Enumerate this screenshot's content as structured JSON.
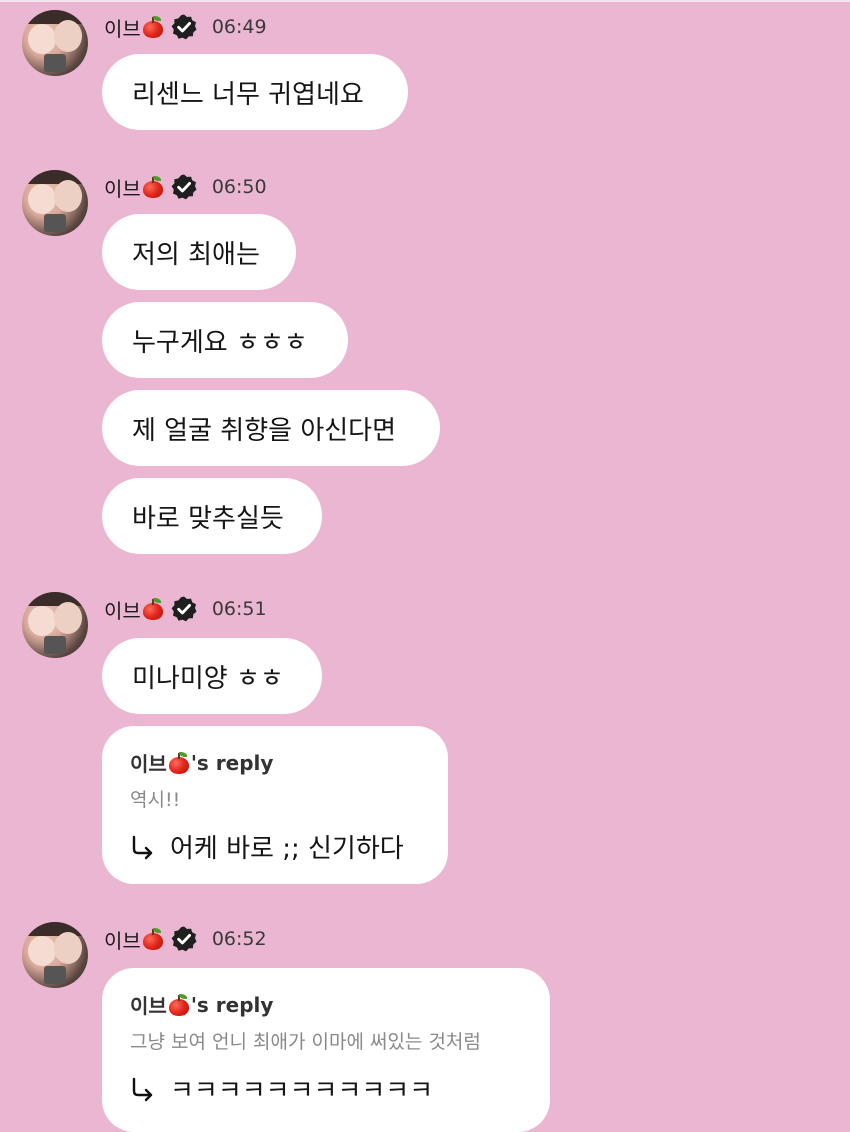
{
  "groups": [
    {
      "sender": "이브",
      "time": "06:49",
      "messages": [
        "리센느 너무 귀엽네요"
      ]
    },
    {
      "sender": "이브",
      "time": "06:50",
      "messages": [
        "저의 최애는",
        "누구게요 ㅎㅎㅎ",
        "제 얼굴 취향을 아신다면",
        "바로 맞추실듯"
      ]
    },
    {
      "sender": "이브",
      "time": "06:51",
      "messages": [
        "미나미양 ㅎㅎ"
      ],
      "reply": {
        "title_prefix": "이브",
        "title_suffix": "'s reply",
        "quote": "역시!!",
        "text": "어케 바로 ;; 신기하다"
      }
    },
    {
      "sender": "이브",
      "time": "06:52",
      "reply": {
        "title_prefix": "이브",
        "title_suffix": "'s reply",
        "quote": "그냥 보여 언니 최애가 이마에 써있는 것처럼",
        "text": "ㅋㅋㅋㅋㅋㅋㅋㅋㅋㅋㅋ"
      }
    }
  ],
  "icons": {
    "apple": "apple-emoji",
    "verified": "verified-badge",
    "reply": "reply-arrow"
  },
  "colors": {
    "background": "#ebb6d2",
    "bubble": "#ffffff",
    "verified": "#1f1f1f"
  }
}
